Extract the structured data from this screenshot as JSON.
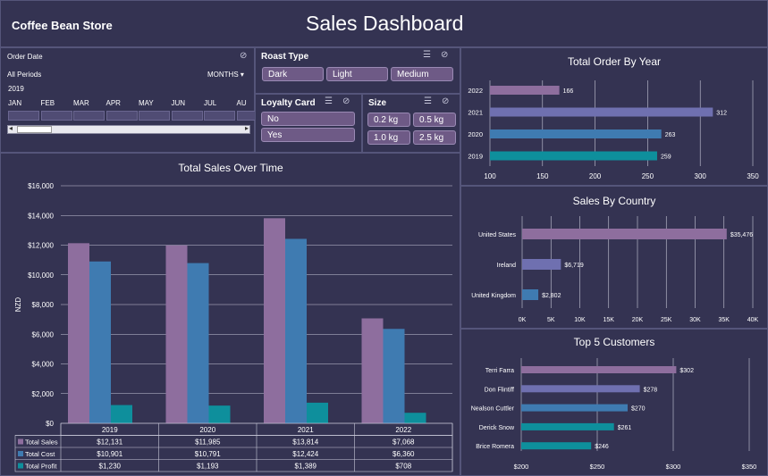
{
  "header": {
    "store_name": "Coffee Bean Store",
    "title": "Sales Dashboard"
  },
  "order_date": {
    "title": "Order Date",
    "period": "All Periods",
    "granularity": "MONTHS",
    "year": "2019",
    "months": [
      "JAN",
      "FEB",
      "MAR",
      "APR",
      "MAY",
      "JUN",
      "JUL",
      "AU"
    ],
    "scroll_fraction": 0.14
  },
  "roast_type": {
    "title": "Roast Type",
    "options": [
      "Dark",
      "Light",
      "Medium"
    ]
  },
  "loyalty_card": {
    "title": "Loyalty Card",
    "options": [
      "No",
      "Yes"
    ]
  },
  "size": {
    "title": "Size",
    "options": [
      "0.2 kg",
      "0.5 kg",
      "1.0 kg",
      "2.5 kg"
    ]
  },
  "colors": {
    "background": "#343352",
    "sales": "#8e6e9e",
    "cost": "#3f7bb1",
    "profit": "#0e8f9c",
    "orders_2022": "#8e6e9e",
    "orders_2021": "#6f70b0",
    "orders_2020": "#3f7bb1",
    "orders_2019": "#0e8f9c"
  },
  "chart_data": [
    {
      "type": "bar",
      "title": "Total Sales Over Time",
      "ylabel": "NZD",
      "categories": [
        "2019",
        "2020",
        "2021",
        "2022"
      ],
      "ylim": [
        0,
        16000
      ],
      "yticks": [
        "$0",
        "$2,000",
        "$4,000",
        "$6,000",
        "$8,000",
        "$10,000",
        "$12,000",
        "$14,000",
        "$16,000"
      ],
      "series": [
        {
          "name": "Total Sales",
          "values": [
            12131,
            11985,
            13814,
            7068
          ],
          "labels": [
            "$12,131",
            "$11,985",
            "$13,814",
            "$7,068"
          ]
        },
        {
          "name": "Total Cost",
          "values": [
            10901,
            10791,
            12424,
            6360
          ],
          "labels": [
            "$10,901",
            "$10,791",
            "$12,424",
            "$6,360"
          ]
        },
        {
          "name": "Total Profit",
          "values": [
            1230,
            1193,
            1389,
            708
          ],
          "labels": [
            "$1,230",
            "$1,193",
            "$1,389",
            "$708"
          ]
        }
      ]
    },
    {
      "type": "bar",
      "title": "Total Order By Year",
      "categories": [
        "2022",
        "2021",
        "2020",
        "2019"
      ],
      "values": [
        166,
        312,
        263,
        259
      ],
      "xlim": [
        100,
        350
      ],
      "xticks": [
        "100",
        "150",
        "200",
        "250",
        "300",
        "350"
      ]
    },
    {
      "type": "bar",
      "title": "Sales By Country",
      "categories": [
        "United States",
        "Ireland",
        "United Kingdom"
      ],
      "values": [
        35476,
        6719,
        2802
      ],
      "labels": [
        "$35,476",
        "$6,719",
        "$2,802"
      ],
      "xlim": [
        0,
        40000
      ],
      "xticks": [
        "0K",
        "5K",
        "10K",
        "15K",
        "20K",
        "25K",
        "30K",
        "35K",
        "40K"
      ]
    },
    {
      "type": "bar",
      "title": "Top 5 Customers",
      "categories": [
        "Terri Farra",
        "Don Flintiff",
        "Nealson Cuttler",
        "Derick Snow",
        "Brice Romera"
      ],
      "values": [
        302,
        278,
        270,
        261,
        246
      ],
      "labels": [
        "$302",
        "$278",
        "$270",
        "$261",
        "$246"
      ],
      "xlim": [
        200,
        350
      ],
      "xticks": [
        "$200",
        "$250",
        "$300",
        "$350"
      ]
    }
  ]
}
